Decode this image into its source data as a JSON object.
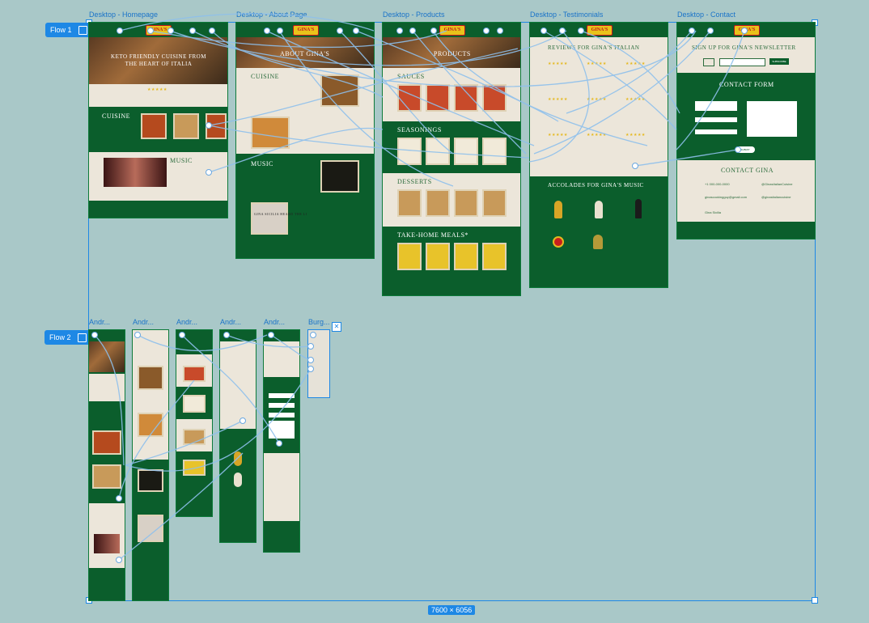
{
  "canvas": {
    "background": "#a9c8c8",
    "selection_size": "7600 × 6056",
    "accent": "#1e88e5"
  },
  "flows": [
    {
      "label": "Flow 1"
    },
    {
      "label": "Flow 2"
    }
  ],
  "frames": {
    "home": {
      "label": "Desktop - Homepage",
      "hero": "KETO FRIENDLY CUISINE FROM THE HEART OF ITALIA",
      "cuisine": "CUISINE",
      "music": "MUSIC"
    },
    "about": {
      "label": "Desktop - About Page",
      "hero": "ABOUT GINA'S",
      "cuisine": "CUISINE",
      "music": "MUSIC",
      "sicilia": "GINA SICILIA HEARD THE LI"
    },
    "products": {
      "label": "Desktop - Products",
      "hero": "PRODUCTS",
      "sauces": "SAUCES",
      "seasonings": "SEASONINGS",
      "desserts": "DESSERTS",
      "meals": "TAKE-HOME MEALS*"
    },
    "testimonials": {
      "label": "Desktop - Testimonials",
      "title": "REVIEWS FOR GINA'S ITALIAN",
      "accolades": "ACCOLADES FOR GINA'S MUSIC"
    },
    "contact": {
      "label": "Desktop - Contact",
      "newsletter": "SIGN UP FOR GINA'S NEWSLETTER",
      "subscribe": "SUBSCRIBE",
      "form": "CONTACT FORM",
      "submit": "SUBMIT",
      "contact": "CONTACT GINA",
      "phone": "+1 000-000-0000",
      "email": "ginascookingguy@gmail.com",
      "facebook": "@GinasItalianCuisine",
      "instagram": "@ginasitaliancuisine",
      "spotify": "Gina Sicilia"
    },
    "mobile": [
      {
        "label": "Andr..."
      },
      {
        "label": "Andr..."
      },
      {
        "label": "Andr..."
      },
      {
        "label": "Andr..."
      },
      {
        "label": "Andr..."
      },
      {
        "label": "Burg..."
      }
    ]
  },
  "logo_text": "GINA'S",
  "colors": {
    "brand_green": "#0b5e2c",
    "cream": "#ece6da",
    "gold": "#e9c21a",
    "red": "#c1121f"
  }
}
